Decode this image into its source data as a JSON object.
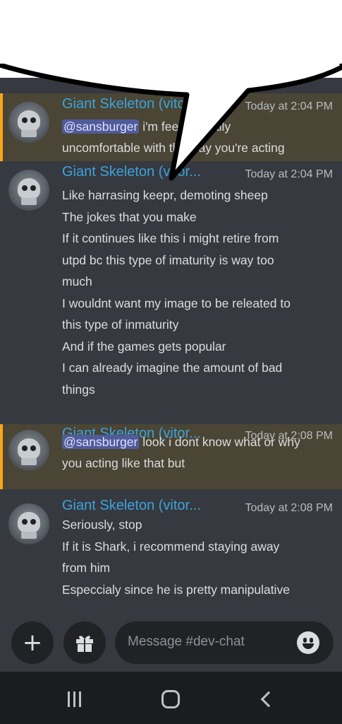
{
  "channel": {
    "placeholder": "Message #dev-chat"
  },
  "messages": [
    {
      "author": "Giant Skeleton (vitor...",
      "time": "Today at 2:04 PM",
      "mentioned": true,
      "lines": [
        {
          "mention": "@sansburger",
          "text": " i'm feeling really"
        },
        {
          "text": "uncomfortable with the way you're acting"
        }
      ]
    },
    {
      "author": "Giant Skeleton (vitor...",
      "time": "Today at 2:04 PM",
      "mentioned": false,
      "lines": [
        {
          "text": "Like harrasing keepr, demoting sheep"
        },
        {
          "text": "The jokes that you make"
        },
        {
          "text": "If it continues like this i might retire from"
        },
        {
          "text": "utpd bc this type of imaturity is way too"
        },
        {
          "text": "much"
        },
        {
          "text": "I wouldnt want my image to be releated to"
        },
        {
          "text": "this type of inmaturity"
        },
        {
          "text": "And if the games gets popular"
        },
        {
          "text": "I can already imagine the amount of bad"
        },
        {
          "text": "things"
        }
      ]
    },
    {
      "author": "Giant Skeleton (vitor...",
      "time": "Today at 2:08 PM",
      "mentioned": true,
      "lines": [
        {
          "mention": "@sansburger",
          "text": " look i dont know what or why"
        },
        {
          "text": "you acting like that but"
        }
      ]
    },
    {
      "author": "Giant Skeleton (vitor...",
      "time": "Today at 2:08 PM",
      "mentioned": false,
      "lines": [
        {
          "text": "Seriously, stop"
        },
        {
          "text": "If it is Shark, i recommend staying away"
        },
        {
          "text": "from him"
        },
        {
          "text": "Especcialy since he is pretty manipulative"
        }
      ]
    }
  ],
  "icons": {
    "add": "plus-icon",
    "gift": "gift-icon",
    "emoji": "emoji-icon",
    "nav": [
      "recents-icon",
      "home-icon",
      "back-icon"
    ]
  },
  "colors": {
    "background": "#36393f",
    "mention_highlight": "#4a4535",
    "mention_bar": "#faa61a",
    "author": "#3ba3dc",
    "text": "#dcddde"
  }
}
